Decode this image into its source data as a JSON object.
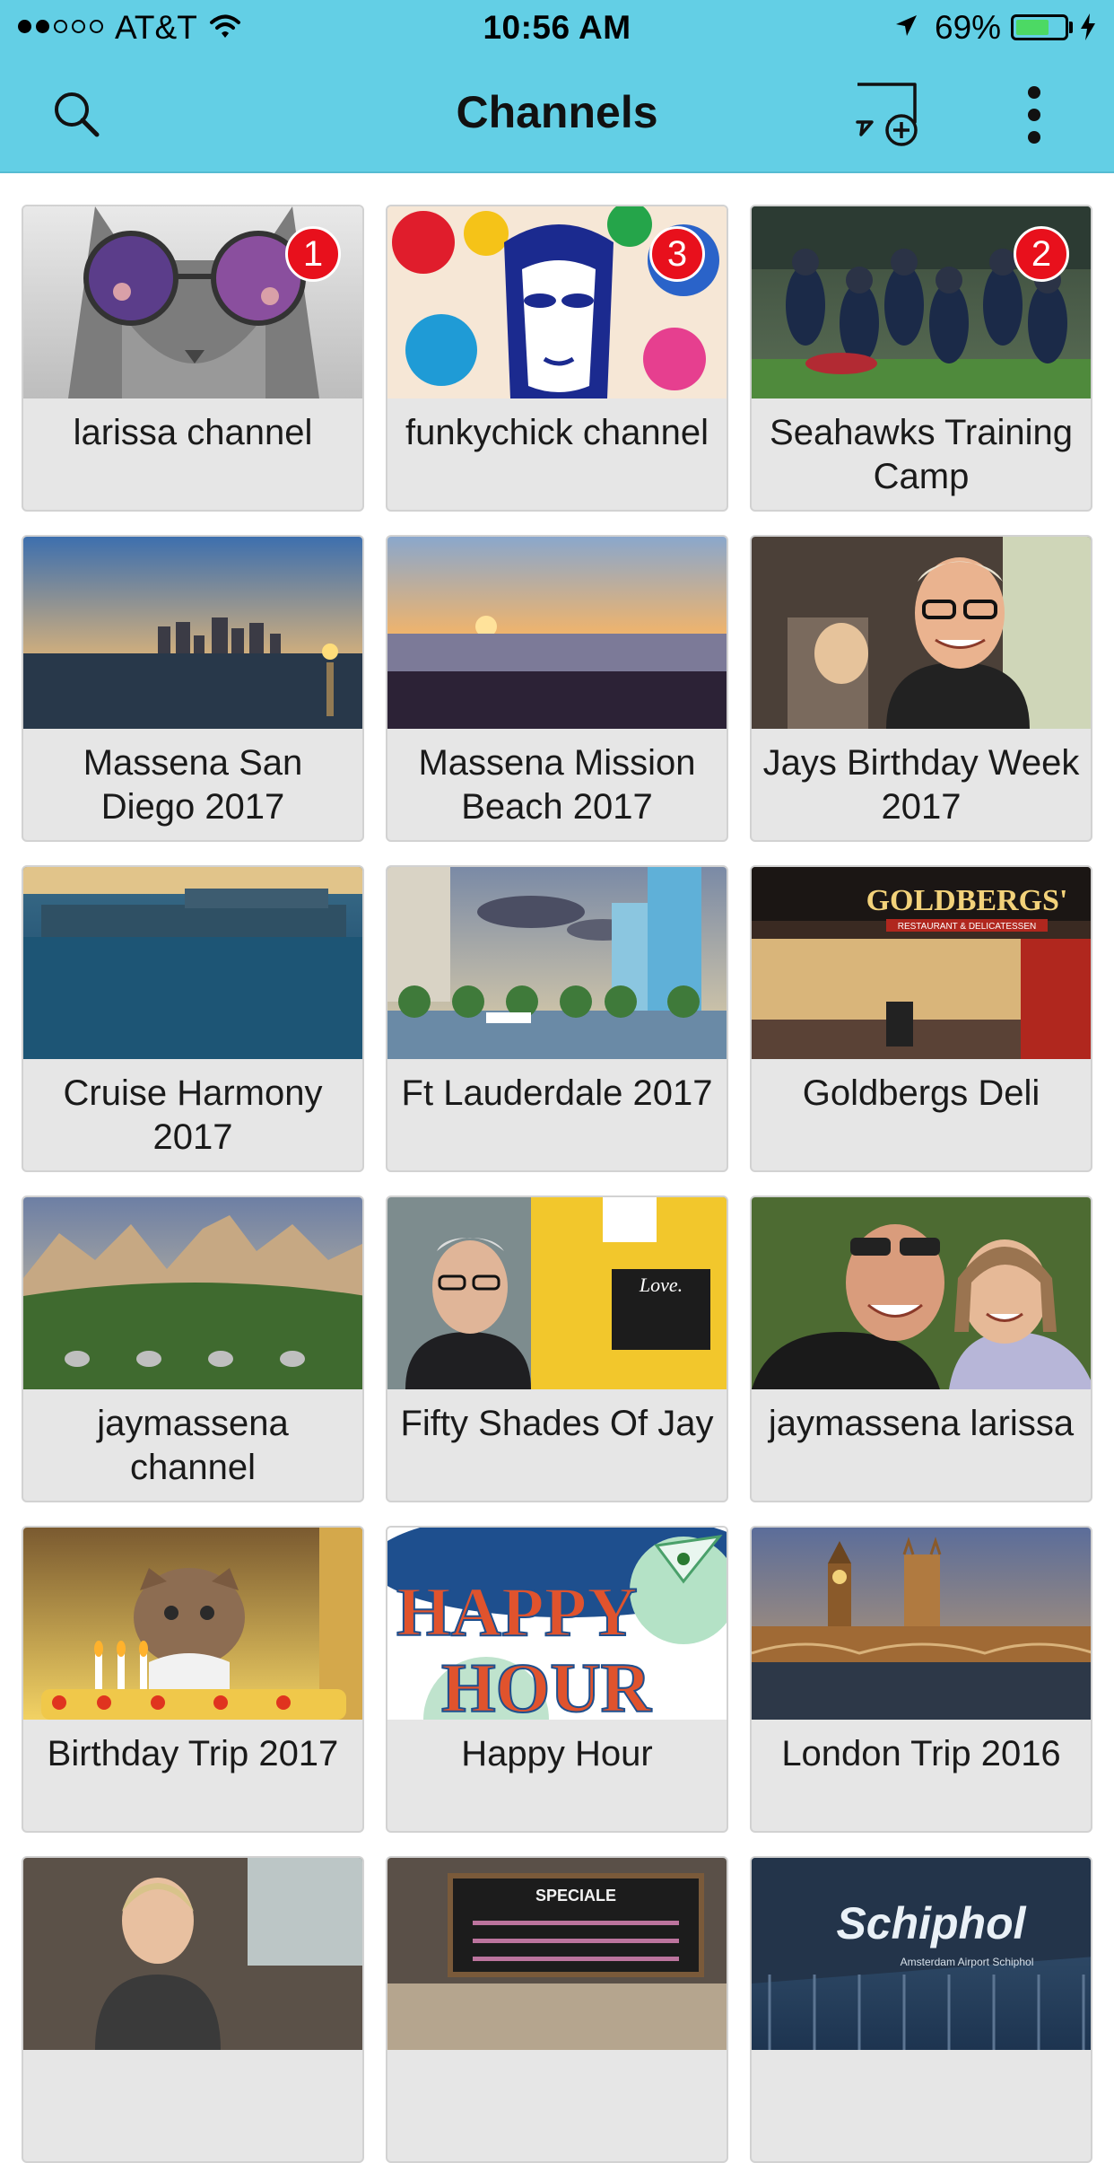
{
  "status_bar": {
    "signal_bars_filled": 2,
    "signal_bars_total": 5,
    "carrier": "AT&T",
    "time": "10:56 AM",
    "battery_percent": "69%",
    "battery_level": 0.69,
    "icons": [
      "wifi-icon",
      "location-arrow-icon",
      "battery-icon",
      "charging-bolt-icon"
    ]
  },
  "header": {
    "title": "Channels",
    "background_color": "#63cfe5",
    "actions": [
      "search-icon",
      "new-chat-icon",
      "more-vertical-icon"
    ]
  },
  "channels": [
    {
      "name": "larissa channel",
      "badge": "1",
      "thumb": "cat-sunglasses"
    },
    {
      "name": "funkychick channel",
      "badge": "3",
      "thumb": "pop-art-face"
    },
    {
      "name": "Seahawks Training Camp",
      "badge": "2",
      "thumb": "football"
    },
    {
      "name": "Massena San Diego 2017",
      "badge": "",
      "thumb": "city-skyline-sunset"
    },
    {
      "name": "Massena Mission Beach 2017",
      "badge": "",
      "thumb": "beach-sunset"
    },
    {
      "name": "Jays Birthday Week 2017",
      "badge": "",
      "thumb": "man-restaurant"
    },
    {
      "name": "Cruise Harmony 2017",
      "badge": "",
      "thumb": "cruise-ship"
    },
    {
      "name": "Ft Lauderdale 2017",
      "badge": "",
      "thumb": "canal-buildings"
    },
    {
      "name": "Goldbergs Deli",
      "badge": "",
      "thumb": "deli-storefront"
    },
    {
      "name": "jaymassena channel",
      "badge": "",
      "thumb": "mountains"
    },
    {
      "name": "Fifty Shades Of Jay",
      "badge": "",
      "thumb": "man-yellow-wall"
    },
    {
      "name": "jaymassena larissa",
      "badge": "",
      "thumb": "couple-selfie"
    },
    {
      "name": "Birthday Trip 2017",
      "badge": "",
      "thumb": "cat-birthday-cake"
    },
    {
      "name": "Happy Hour",
      "badge": "",
      "thumb": "happy-hour-sign"
    },
    {
      "name": "London Trip 2016",
      "badge": "",
      "thumb": "parliament-night"
    },
    {
      "name": "",
      "badge": "",
      "thumb": "woman-cafe"
    },
    {
      "name": "",
      "badge": "",
      "thumb": "menu-board"
    },
    {
      "name": "",
      "badge": "",
      "thumb": "schiphol-airport"
    }
  ],
  "thumb_text": {
    "deli_sign": "GOLDBERGS'",
    "deli_sub": "RESTAURANT & DELICATESSEN",
    "love_board": "Love.",
    "happy": "HAPPY",
    "hour": "HOUR",
    "menu": "SPECIALE",
    "airport": "Schiphol",
    "airport_sub": "Amsterdam Airport Schiphol"
  }
}
